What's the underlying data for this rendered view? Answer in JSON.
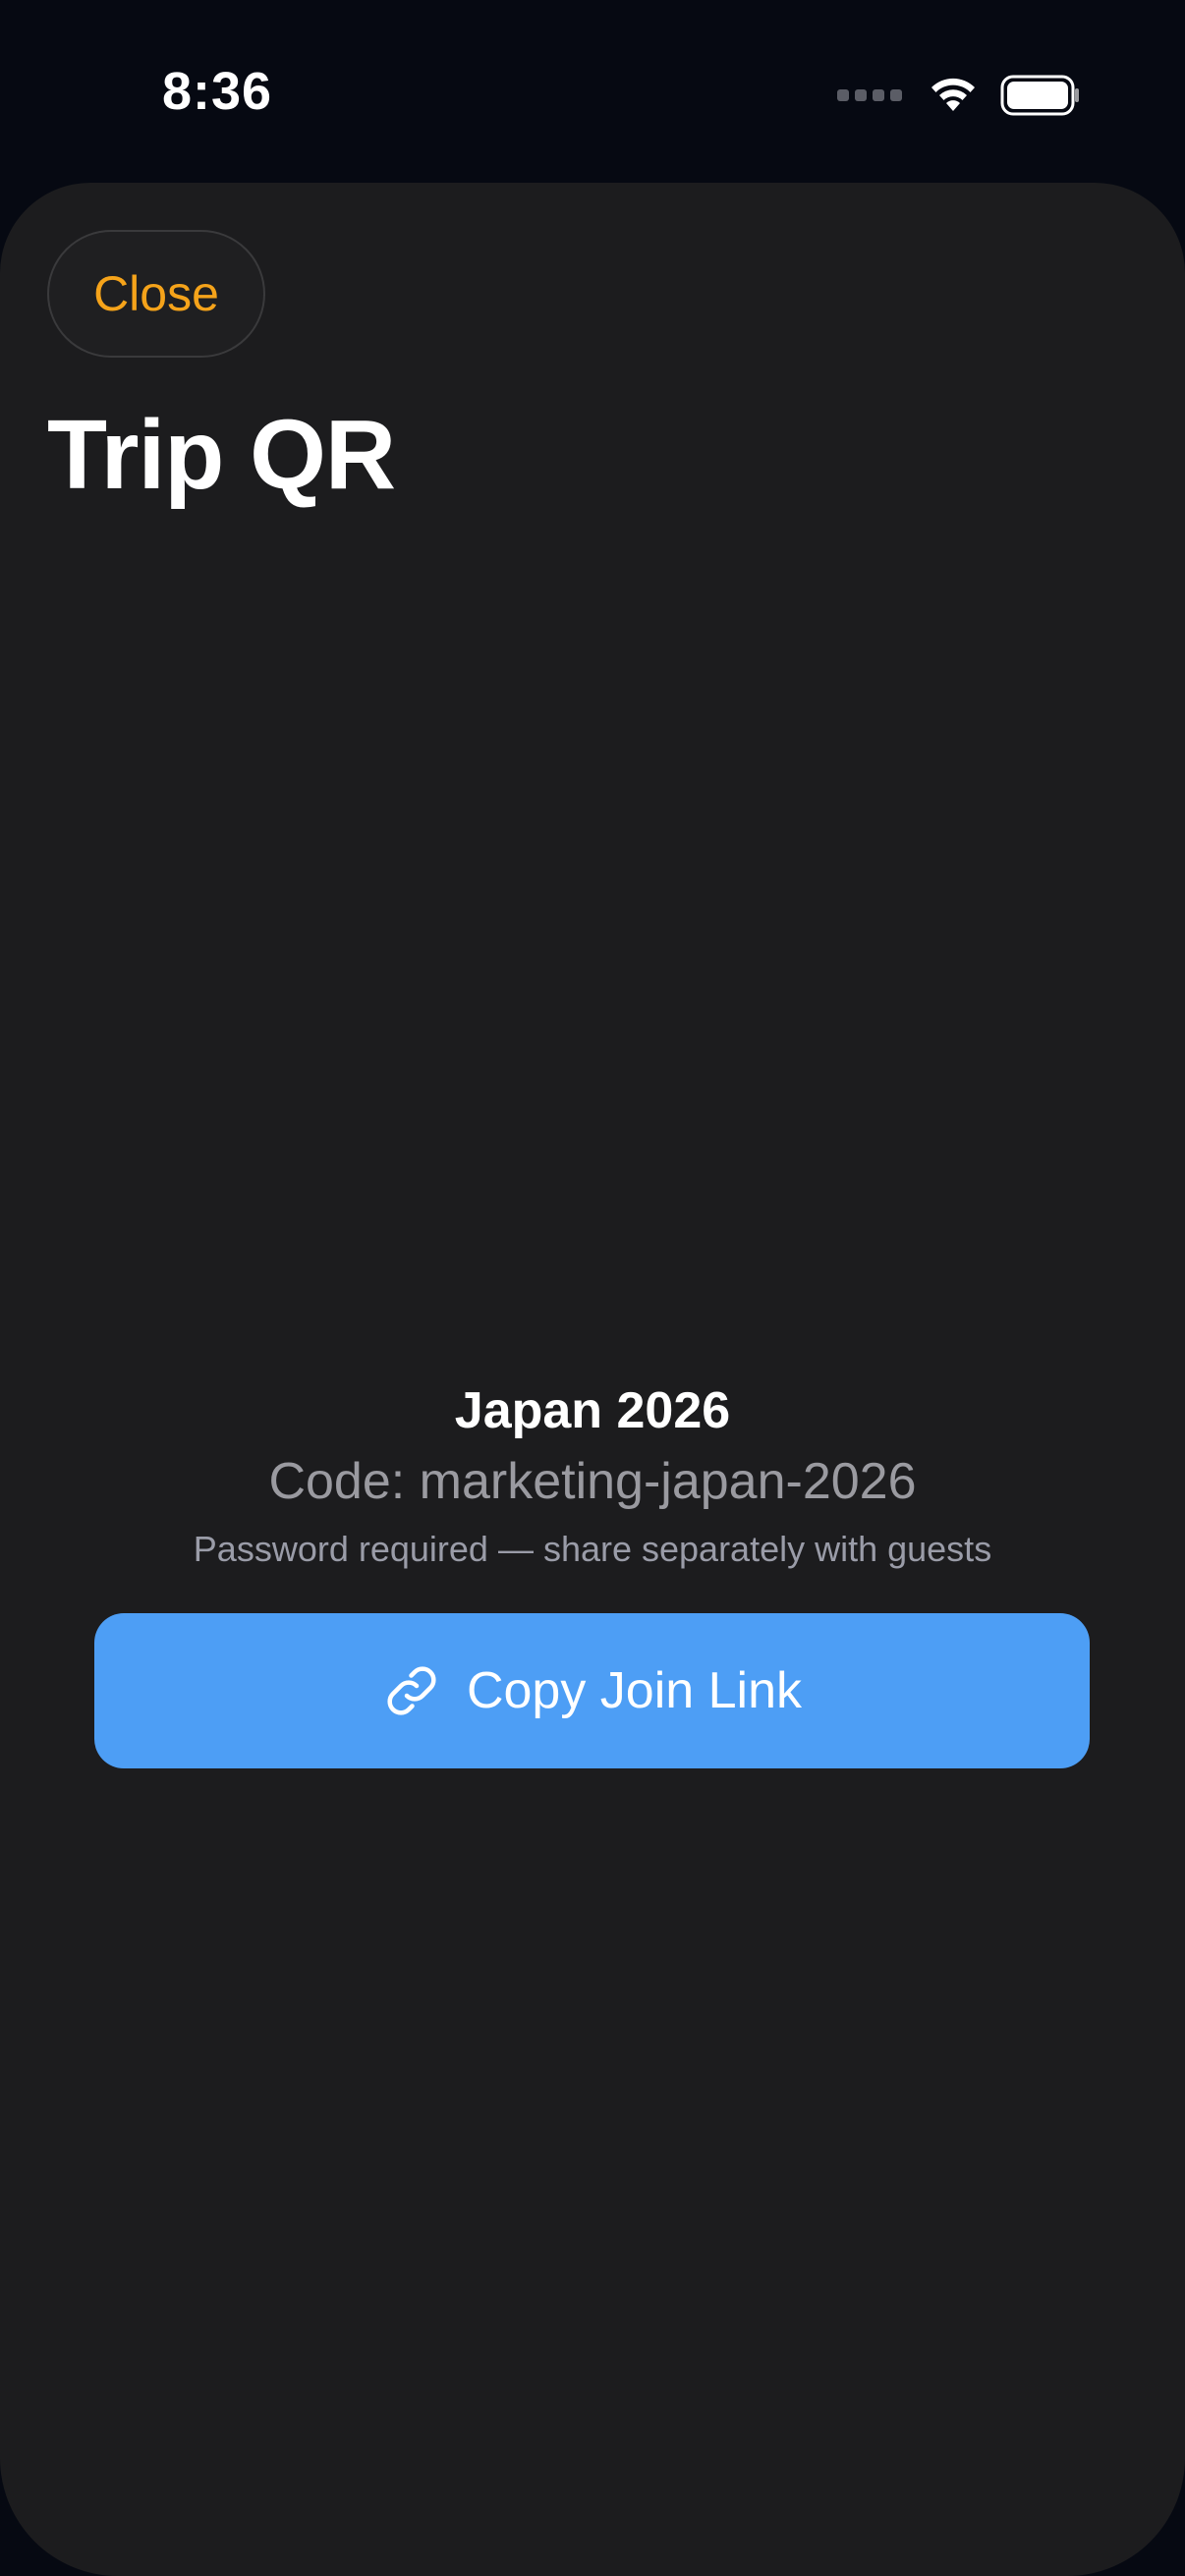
{
  "status_bar": {
    "time": "8:36"
  },
  "sheet": {
    "close_label": "Close",
    "title": "Trip QR"
  },
  "trip": {
    "name": "Japan 2026",
    "code": "Code: marketing-japan-2026",
    "note": "Password required — share separately with guests"
  },
  "actions": {
    "copy_label": "Copy Join Link"
  },
  "colors": {
    "accent_orange": "#f5a31a",
    "button_blue": "#4d9ef5",
    "sheet_background": "#1c1c1e",
    "screen_background": "#060912"
  },
  "icons": {
    "copy": "link-icon",
    "wifi": "wifi-icon",
    "battery": "battery-icon",
    "signal": "cellular-signal-icon"
  }
}
